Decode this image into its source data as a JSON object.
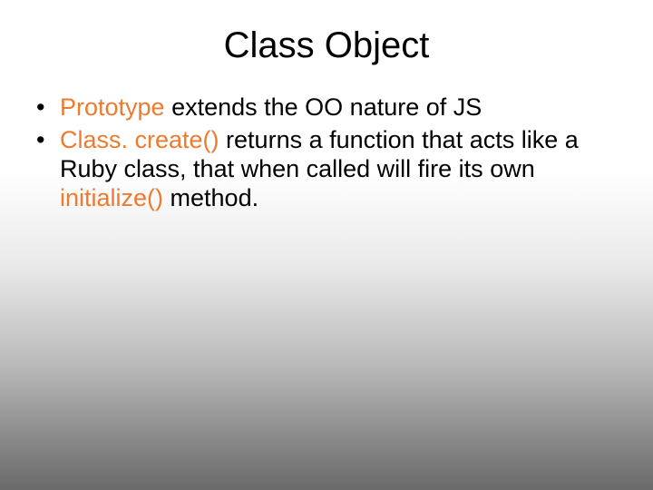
{
  "title": "Class Object",
  "bullets": [
    {
      "pre": "",
      "hl": "Prototype",
      "mid": " extends the OO nature of JS",
      "hl2": "",
      "post": ""
    },
    {
      "pre": "",
      "hl": "Class. create()",
      "mid": " returns a function that acts like a Ruby class, that when called will fire its own ",
      "hl2": "initialize()",
      "post": " method."
    }
  ]
}
